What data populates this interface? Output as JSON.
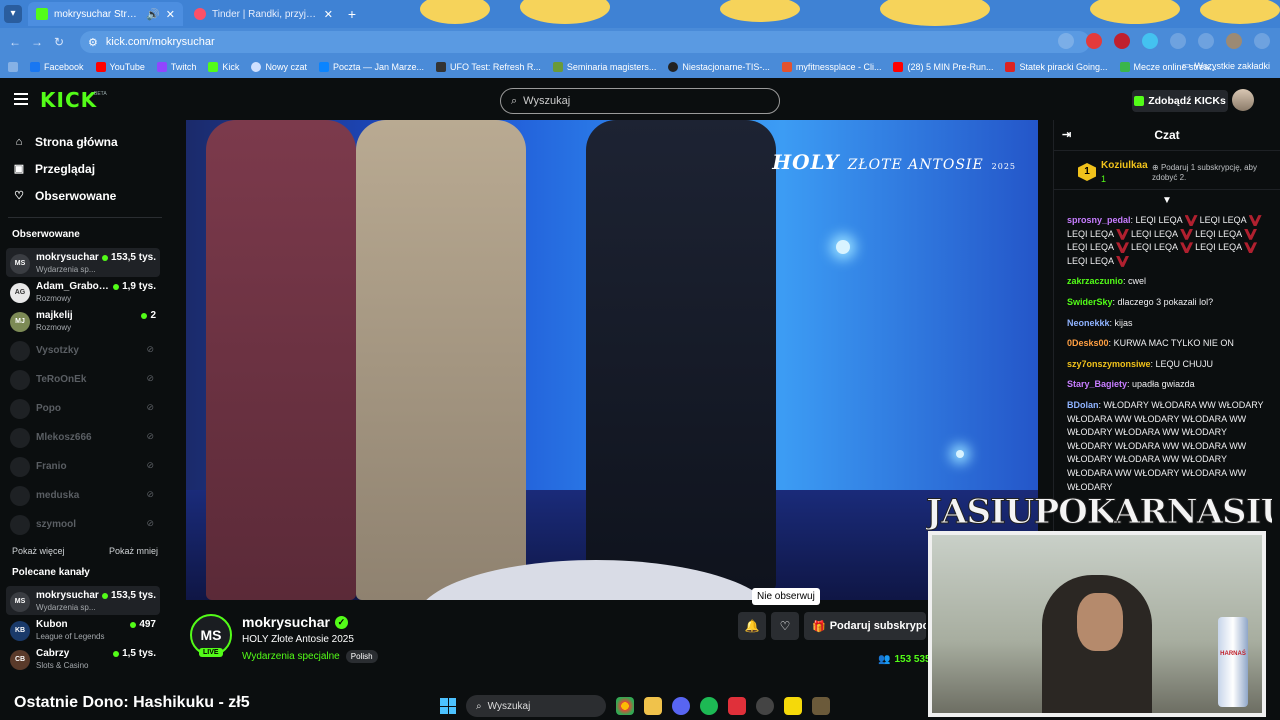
{
  "browser": {
    "tabs": [
      {
        "title": "mokrysuchar Stream - Watch",
        "active": true
      },
      {
        "title": "Tinder | Randki, przyjaźń, nowe",
        "active": false
      }
    ],
    "url": "kick.com/mokrysuchar",
    "bookmarks": [
      "Facebook",
      "YouTube",
      "Twitch",
      "Kick",
      "Nowy czat",
      "Poczta — Jan Marze...",
      "UFO Test: Refresh R...",
      "Seminaria magisters...",
      "Niestacjonarne-TIS-...",
      "myfitnessplace - Cli...",
      "(28) 5 MIN Pre-Run...",
      "Statek piracki Going...",
      "Mecze online strea..."
    ],
    "all_bookmarks": "Wszystkie zakładki"
  },
  "header": {
    "logo": "KICK",
    "logo_beta": "BETA",
    "search_placeholder": "Wyszukaj",
    "get_kicks": "Zdobądź KICKs"
  },
  "sidebar": {
    "nav": [
      {
        "label": "Strona główna",
        "icon": "home-icon"
      },
      {
        "label": "Przeglądaj",
        "icon": "browse-icon"
      },
      {
        "label": "Obserwowane",
        "icon": "heart-icon"
      }
    ],
    "following_title": "Obserwowane",
    "following": [
      {
        "name": "mokrysuchar",
        "category": "Wydarzenia sp...",
        "viewers": "153,5 tys.",
        "live": true,
        "initials": "MS"
      },
      {
        "name": "Adam_Grabowi...",
        "category": "Rozmowy",
        "viewers": "1,9 tys.",
        "live": true,
        "initials": "AG"
      },
      {
        "name": "majkelij",
        "category": "Rozmowy",
        "viewers": "2",
        "live": true,
        "initials": "MJ"
      },
      {
        "name": "Vysotzky",
        "live": false
      },
      {
        "name": "TeRoOnEk",
        "live": false
      },
      {
        "name": "Popo",
        "live": false
      },
      {
        "name": "Mlekosz666",
        "live": false
      },
      {
        "name": "Franio",
        "live": false
      },
      {
        "name": "meduska",
        "live": false
      },
      {
        "name": "szymool",
        "live": false
      }
    ],
    "show_more": "Pokaż więcej",
    "show_less": "Pokaż mniej",
    "recommended_title": "Polecane kanały",
    "recommended": [
      {
        "name": "mokrysuchar",
        "category": "Wydarzenia sp...",
        "viewers": "153,5 tys.",
        "initials": "MS"
      },
      {
        "name": "Kubon",
        "category": "League of Legends",
        "viewers": "497",
        "initials": "KB"
      },
      {
        "name": "Cabrzy",
        "category": "Slots & Casino",
        "viewers": "1,5 tys.",
        "initials": "CB"
      }
    ]
  },
  "video": {
    "overlay_brand": "HOLY",
    "overlay_title": "ZŁOTE ANTOSIE",
    "overlay_year": "2025"
  },
  "stream": {
    "avatar_initials": "MS",
    "live_label": "LIVE",
    "streamer": "mokrysuchar",
    "title": "HOLY Złote Antosie 2025",
    "category": "Wydarzenia specjalne",
    "language": "Polish",
    "tooltip": "Nie obserwuj",
    "subscribe": "Podaruj subskrypcję",
    "viewers": "153 535"
  },
  "chat": {
    "title": "Czat",
    "pinned": {
      "rank": "1",
      "user": "Koziulkaa",
      "count": "1",
      "text": "Podaruj 1 subskrypcję, aby zdobyć 2."
    },
    "messages": [
      {
        "user": "sprosny_pedal",
        "color": "#c77dff",
        "text": "LEQI LEQA",
        "emotes": true
      },
      {
        "user": "zakrzaczunio",
        "color": "#53fc18",
        "text": "cwel"
      },
      {
        "user": "SwiderSky",
        "color": "#53fc18",
        "text": "dlaczego 3 pokazali lol?"
      },
      {
        "user": "Neonekkk",
        "color": "#8fb3ff",
        "text": "kijas"
      },
      {
        "user": "0Desks00",
        "color": "#ff9f43",
        "text": "KURWA MAC TYLKO NIE ON"
      },
      {
        "user": "szy7onszymonsiwe",
        "color": "#f1c21b",
        "text": "LEQU CHUJU"
      },
      {
        "user": "Stary_Bagiety",
        "color": "#c77dff",
        "text": "upadła gwiazda"
      },
      {
        "user": "BDolan",
        "color": "#8fb3ff",
        "text": "WŁODARY WŁODARA WW WŁODARY WŁODARA WW WŁODARY WŁODARA WW WŁODARY WŁODARA WW WŁODARY WŁODARY WŁODARA WW WŁODARA WW WŁODARY WŁODARA WW WŁODARY WŁODARA WW WŁODARY WŁODARA WW WŁODARY"
      }
    ]
  },
  "webcam": {
    "title": "JASIUPOKARNASIU",
    "can_label": "HARNAŚ"
  },
  "donation": "Ostatnie Dono: Hashikuku - zł5",
  "taskbar": {
    "search": "Wyszukaj"
  }
}
